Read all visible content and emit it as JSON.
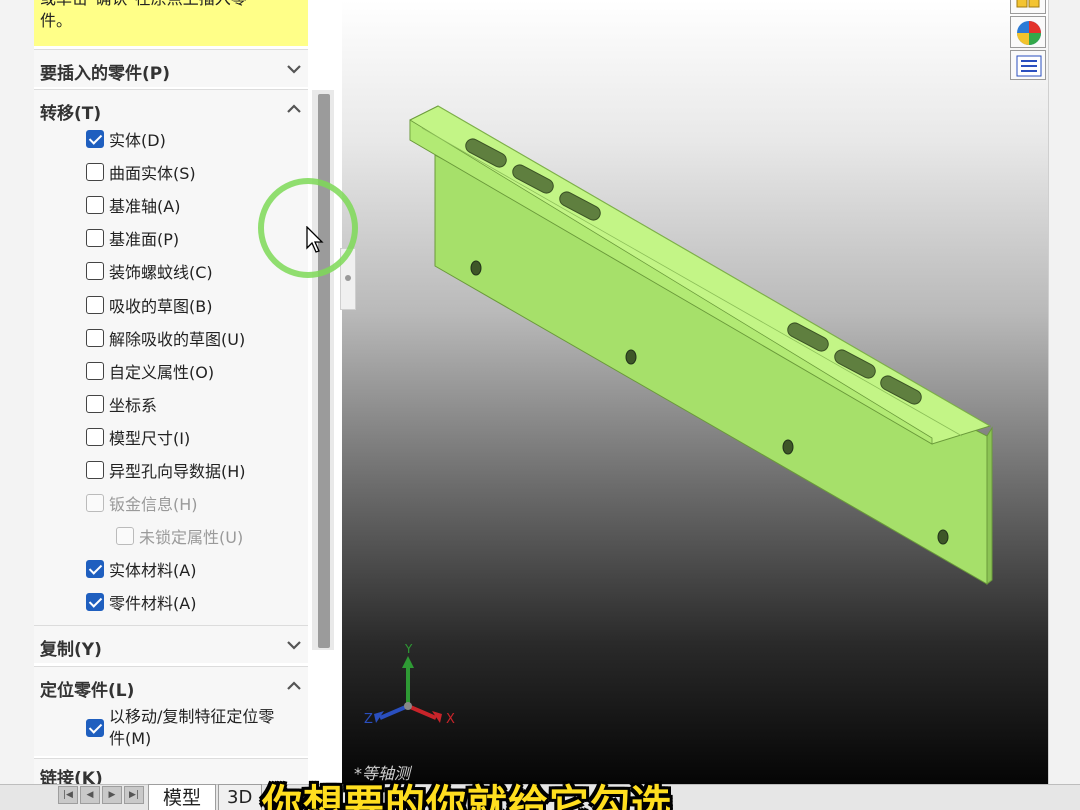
{
  "message": {
    "line1": "或单击\"确认\"在原点上插入零",
    "line2": "件。"
  },
  "sections": {
    "insert_part": {
      "title": "要插入的零件(P)",
      "state": "collapsed"
    },
    "transfer": {
      "title": "转移(T)",
      "state": "expanded",
      "options": [
        {
          "label": "实体(D)",
          "checked": true,
          "enabled": true
        },
        {
          "label": "曲面实体(S)",
          "checked": false,
          "enabled": true
        },
        {
          "label": "基准轴(A)",
          "checked": false,
          "enabled": true
        },
        {
          "label": "基准面(P)",
          "checked": false,
          "enabled": true
        },
        {
          "label": "装饰螺蚊线(C)",
          "checked": false,
          "enabled": true
        },
        {
          "label": "吸收的草图(B)",
          "checked": false,
          "enabled": true
        },
        {
          "label": "解除吸收的草图(U)",
          "checked": false,
          "enabled": true
        },
        {
          "label": "自定义属性(O)",
          "checked": false,
          "enabled": true
        },
        {
          "label": "坐标系",
          "checked": false,
          "enabled": true
        },
        {
          "label": "模型尺寸(I)",
          "checked": false,
          "enabled": true
        },
        {
          "label": "异型孔向导数据(H)",
          "checked": false,
          "enabled": true
        },
        {
          "label": "钣金信息(H)",
          "checked": false,
          "enabled": false
        },
        {
          "label": "未锁定属性(U)",
          "checked": false,
          "enabled": false
        },
        {
          "label": "实体材料(A)",
          "checked": true,
          "enabled": true
        },
        {
          "label": "零件材料(A)",
          "checked": true,
          "enabled": true
        }
      ]
    },
    "copy": {
      "title": "复制(Y)",
      "state": "collapsed"
    },
    "locate": {
      "title": "定位零件(L)",
      "state": "expanded",
      "option": {
        "line1": "以移动/复制特征定位零",
        "line2": "件(M)",
        "checked": true
      }
    },
    "link": {
      "title": "链接(K)"
    }
  },
  "viewport": {
    "view_label": "*等轴测",
    "axes": {
      "x": "X",
      "y": "Y",
      "z": "Z"
    },
    "part_color": "#b8f27a"
  },
  "bottom_tabs": {
    "model": "模型",
    "three_d": "3D"
  },
  "caption": "你想要的你就给它勾选",
  "colors": {
    "accent": "#1f5fbf",
    "message_bg": "#ffff88",
    "caption": "#ffde1f",
    "highlight_ring": "#7ed957"
  }
}
